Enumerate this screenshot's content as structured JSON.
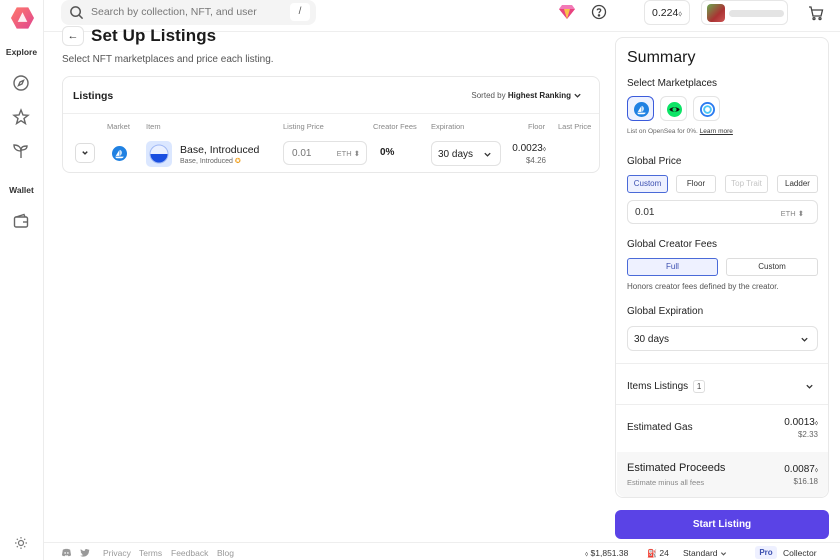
{
  "sidebar": {
    "explore_label": "Explore",
    "wallet_label": "Wallet",
    "icons": [
      "compass-icon",
      "star-icon",
      "sprout-icon",
      "wallet-icon",
      "sun-icon"
    ]
  },
  "topbar": {
    "search_placeholder": "Search by collection, NFT, and user",
    "search_shortcut": "/",
    "balance": "0.224"
  },
  "page": {
    "back_label": "←",
    "title": "Set Up Listings",
    "subtitle": "Select NFT marketplaces and price each listing."
  },
  "listings": {
    "title": "Listings",
    "sort_prefix": "Sorted by",
    "sort_value": "Highest Ranking",
    "columns": [
      "Market",
      "Item",
      "Listing Price",
      "Creator Fees",
      "Expiration",
      "Floor",
      "Last Price"
    ],
    "rows": [
      {
        "name": "Base, Introduced",
        "collection": "Base, Introduced",
        "price_placeholder": "0.01",
        "price_unit": "ETH",
        "creator_fees": "0%",
        "expiration": "30 days",
        "floor_eth": "0.0023",
        "floor_usd": "$4.26"
      }
    ]
  },
  "summary": {
    "title": "Summary",
    "select_marketplaces": "Select Marketplaces",
    "marketplace_note": "List on OpenSea for 0%.",
    "learn_more": "Learn more",
    "global_price_label": "Global Price",
    "price_modes": [
      "Custom",
      "Floor",
      "Top Trait",
      "Ladder"
    ],
    "global_price_value": "0.01",
    "global_price_unit": "ETH",
    "creator_fees_label": "Global Creator Fees",
    "fee_modes": [
      "Full",
      "Custom"
    ],
    "fees_note": "Honors creator fees defined by the creator.",
    "expiration_label": "Global Expiration",
    "expiration_value": "30 days",
    "items_label": "Items Listings",
    "items_count": "1",
    "gas_label": "Estimated Gas",
    "gas_eth": "0.0013",
    "gas_usd": "$2.33",
    "proceeds_label": "Estimated Proceeds",
    "proceeds_sub": "Estimate minus all fees",
    "proceeds_eth": "0.0087",
    "proceeds_usd": "$16.18",
    "start_button": "Start Listing"
  },
  "footer": {
    "links": [
      "Privacy",
      "Terms",
      "Feedback",
      "Blog"
    ],
    "eth_price": "$1,851.38",
    "gas": "24",
    "mode": "Standard",
    "pro": "Pro",
    "collector": "Collector"
  },
  "colors": {
    "accent": "#5a43e6",
    "selected_border": "#4a6ad8",
    "opensea_blue": "#2081e2"
  }
}
